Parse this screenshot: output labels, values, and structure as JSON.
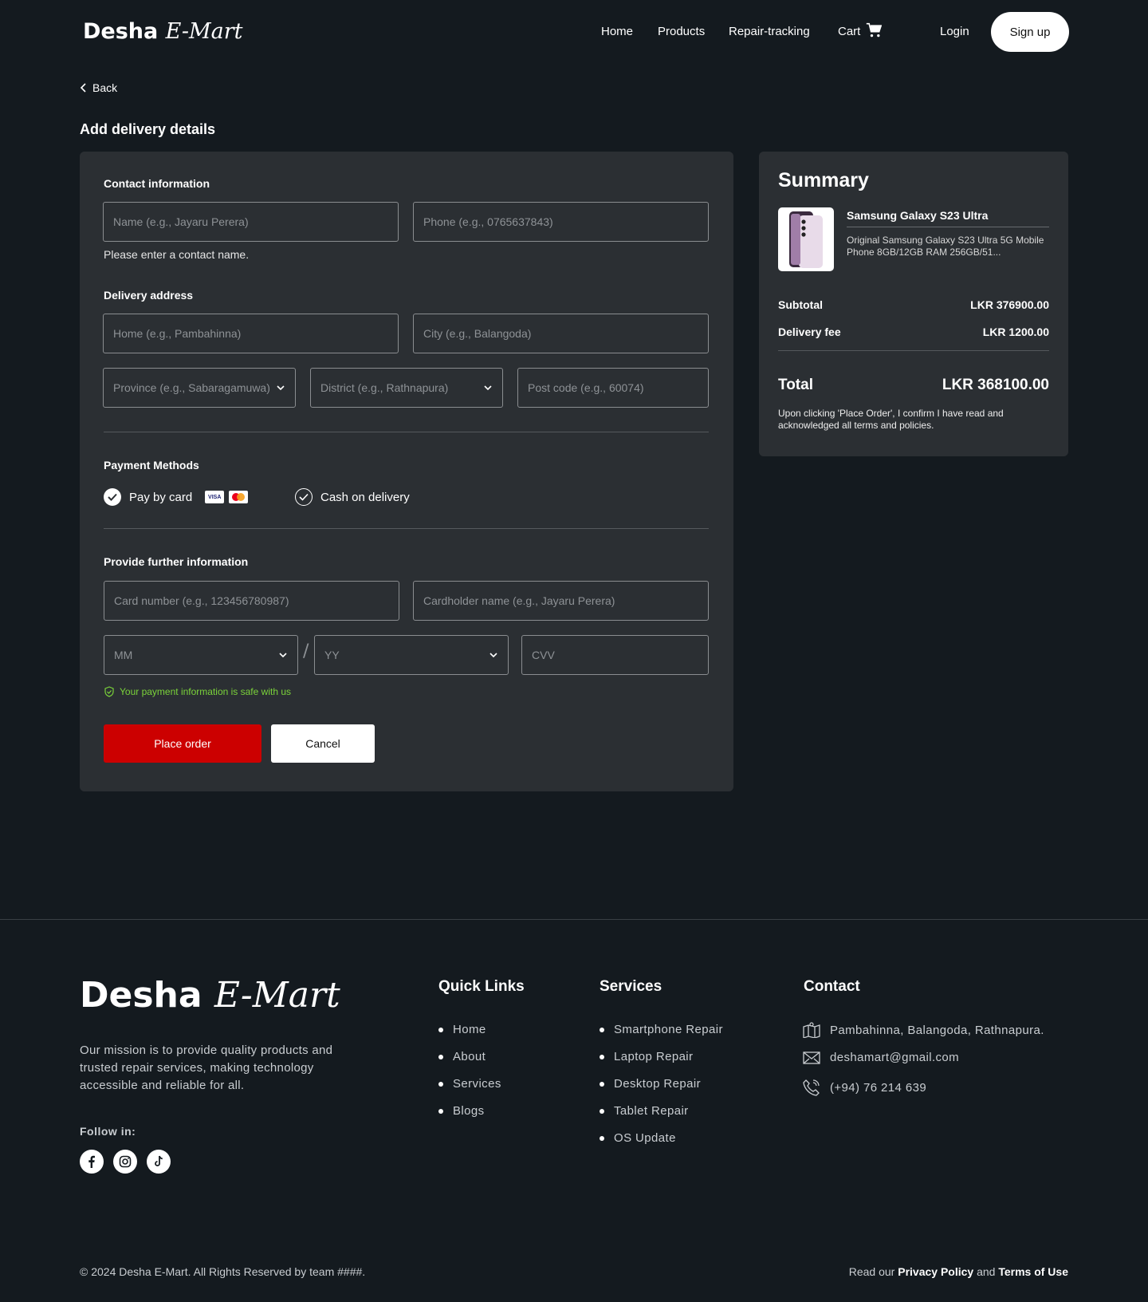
{
  "brand": {
    "name": "Desha",
    "script": "E-Mart"
  },
  "nav": {
    "home": "Home",
    "products": "Products",
    "repair_tracking": "Repair-tracking",
    "cart": "Cart",
    "login": "Login",
    "signup": "Sign up"
  },
  "back_label": "Back",
  "page_title": "Add delivery details",
  "contact": {
    "title": "Contact information",
    "name_placeholder": "Name (e.g., Jayaru Perera)",
    "phone_placeholder": "Phone (e.g., 0765637843)",
    "error": "Please enter a contact name."
  },
  "address": {
    "title": "Delivery address",
    "home_placeholder": "Home (e.g., Pambahinna)",
    "city_placeholder": "City (e.g., Balangoda)",
    "province_placeholder": "Province (e.g., Sabaragamuwa)",
    "district_placeholder": "District (e.g., Rathnapura)",
    "postcode_placeholder": "Post code (e.g., 60074)"
  },
  "payment": {
    "title": "Payment Methods",
    "card_label": "Pay by card",
    "visa": "VISA",
    "cod_label": "Cash on delivery",
    "selected": "Pay by card"
  },
  "further": {
    "title": "Provide further information",
    "card_number_placeholder": "Card number (e.g., 123456780987)",
    "cardholder_placeholder": "Cardholder name (e.g., Jayaru Perera)",
    "mm": "MM",
    "separator": "/",
    "yy": "YY",
    "cvv_placeholder": "CVV",
    "safe_note": "Your payment information is safe with us"
  },
  "buttons": {
    "place_order": "Place order",
    "cancel": "Cancel"
  },
  "summary": {
    "title": "Summary",
    "product_name": "Samsung Galaxy S23 Ultra",
    "product_desc": "Original Samsung Galaxy S23 Ultra 5G Mobile Phone 8GB/12GB RAM 256GB/51...",
    "subtotal_label": "Subtotal",
    "subtotal_value": "LKR 376900.00",
    "delivery_label": "Delivery fee",
    "delivery_value": "LKR 1200.00",
    "total_label": "Total",
    "total_value": "LKR 368100.00",
    "terms": "Upon clicking 'Place Order', I confirm I have read and acknowledged all terms and policies."
  },
  "footer": {
    "mission": "Our mission is to provide quality products and trusted repair services, making technology accessible and reliable for all.",
    "follow": "Follow in:",
    "quick_links_title": "Quick Links",
    "quick_links": [
      "Home",
      "About",
      "Services",
      "Blogs"
    ],
    "services_title": "Services",
    "services": [
      "Smartphone Repair",
      "Laptop Repair",
      "Desktop Repair",
      "Tablet Repair",
      "OS Update"
    ],
    "contact_title": "Contact",
    "address": "Pambahinna, Balangoda, Rathnapura.",
    "email": "deshamart@gmail.com",
    "phone": "(+94) 76 214 639",
    "copyright": "© 2024 Desha E-Mart. All Rights Reserved by team ####.",
    "policy_prefix": "Read our",
    "privacy": "Privacy Policy",
    "and": "and",
    "terms": "Terms of Use"
  },
  "colors": {
    "accent": "#cc0000",
    "background": "#141a1f",
    "card": "#2b2f33",
    "safe": "#7bd33a"
  }
}
